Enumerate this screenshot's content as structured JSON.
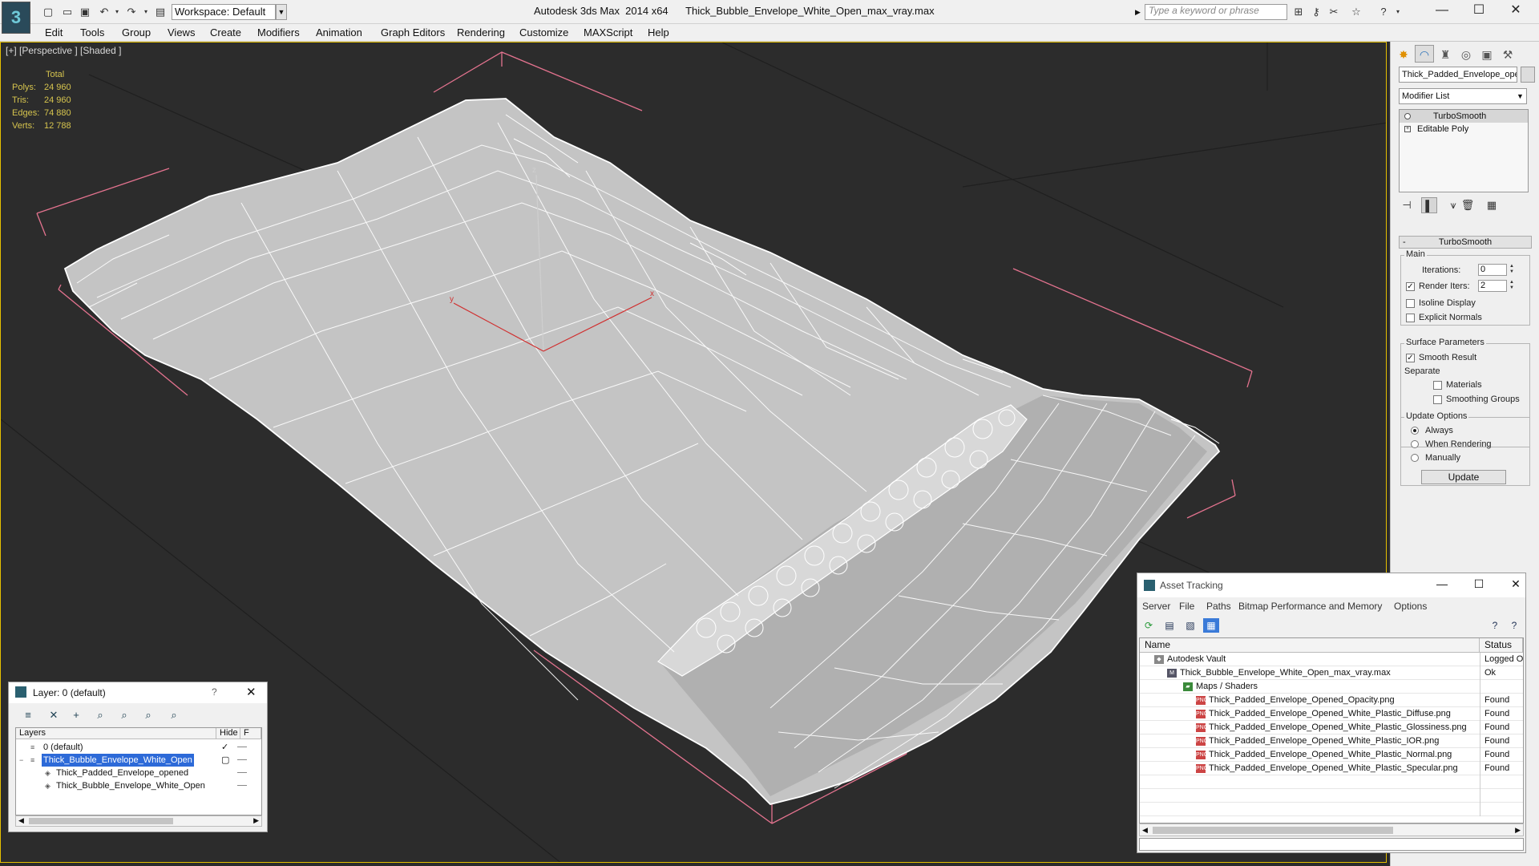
{
  "titlebar": {
    "app_title": "Autodesk 3ds Max  2014 x64",
    "file_name": "Thick_Bubble_Envelope_White_Open_max_vray.max",
    "workspace_value": "Workspace: Default",
    "search_placeholder": "Type a keyword or phrase"
  },
  "menubar": {
    "items": [
      "Edit",
      "Tools",
      "Group",
      "Views",
      "Create",
      "Modifiers",
      "Animation",
      "Graph Editors",
      "Rendering",
      "Customize",
      "MAXScript",
      "Help"
    ]
  },
  "viewport": {
    "label": "[+] [Perspective ] [Shaded ]",
    "stats": {
      "header": "Total",
      "polys_label": "Polys:",
      "polys_value": "24 960",
      "tris_label": "Tris:",
      "tris_value": "24 960",
      "edges_label": "Edges:",
      "edges_value": "74 880",
      "verts_label": "Verts:",
      "verts_value": "12 788"
    },
    "axis_labels": {
      "z": "z",
      "y": "y",
      "x": "x"
    }
  },
  "command_panel": {
    "object_name": "Thick_Padded_Envelope_ope",
    "modifier_list": "Modifier List",
    "stack": [
      "TurboSmooth",
      "Editable Poly"
    ],
    "rollout_title": "TurboSmooth",
    "main_group": "Main",
    "iterations_label": "Iterations:",
    "iterations_value": "0",
    "render_iters_label": "Render Iters:",
    "render_iters_value": "2",
    "isoline_label": "Isoline Display",
    "explicit_normals_label": "Explicit Normals",
    "surface_group": "Surface Parameters",
    "smooth_result_label": "Smooth Result",
    "separate_label": "Separate",
    "materials_label": "Materials",
    "smoothing_groups_label": "Smoothing Groups",
    "update_group": "Update Options",
    "always_label": "Always",
    "when_rendering_label": "When Rendering",
    "manually_label": "Manually",
    "update_button": "Update"
  },
  "layer_dialog": {
    "title": "Layer: 0 (default)",
    "help": "?",
    "col_layers": "Layers",
    "col_hide": "Hide",
    "col_f": "F",
    "rows": [
      "0 (default)",
      "Thick_Bubble_Envelope_White_Open",
      "Thick_Padded_Envelope_opened",
      "Thick_Bubble_Envelope_White_Open"
    ]
  },
  "asset_dialog": {
    "title": "Asset Tracking",
    "menus": [
      "Server",
      "File",
      "Paths",
      "Bitmap Performance and Memory",
      "Options"
    ],
    "col_name": "Name",
    "col_status": "Status",
    "rows": [
      {
        "name": "Autodesk Vault",
        "status": "Logged O"
      },
      {
        "name": "Thick_Bubble_Envelope_White_Open_max_vray.max",
        "status": "Ok"
      },
      {
        "name": "Maps / Shaders",
        "status": ""
      },
      {
        "name": "Thick_Padded_Envelope_Opened_Opacity.png",
        "status": "Found"
      },
      {
        "name": "Thick_Padded_Envelope_Opened_White_Plastic_Diffuse.png",
        "status": "Found"
      },
      {
        "name": "Thick_Padded_Envelope_Opened_White_Plastic_Glossiness.png",
        "status": "Found"
      },
      {
        "name": "Thick_Padded_Envelope_Opened_White_Plastic_IOR.png",
        "status": "Found"
      },
      {
        "name": "Thick_Padded_Envelope_Opened_White_Plastic_Normal.png",
        "status": "Found"
      },
      {
        "name": "Thick_Padded_Envelope_Opened_White_Plastic_Specular.png",
        "status": "Found"
      }
    ],
    "png_badge": "PNG"
  },
  "colors": {
    "viewport_bg": "#2c2c2c",
    "stats_text": "#d6c44e",
    "selection_blue": "#2d6ad8",
    "bbox_pink": "#e4738f",
    "mesh_fill": "#c4c4c4",
    "wire": "#ffffff"
  },
  "icons": {
    "logo": "3ds-max-logo",
    "quick_access": [
      "new-file-icon",
      "open-file-icon",
      "save-icon",
      "undo-icon",
      "redo-icon",
      "project-folder-icon"
    ]
  }
}
